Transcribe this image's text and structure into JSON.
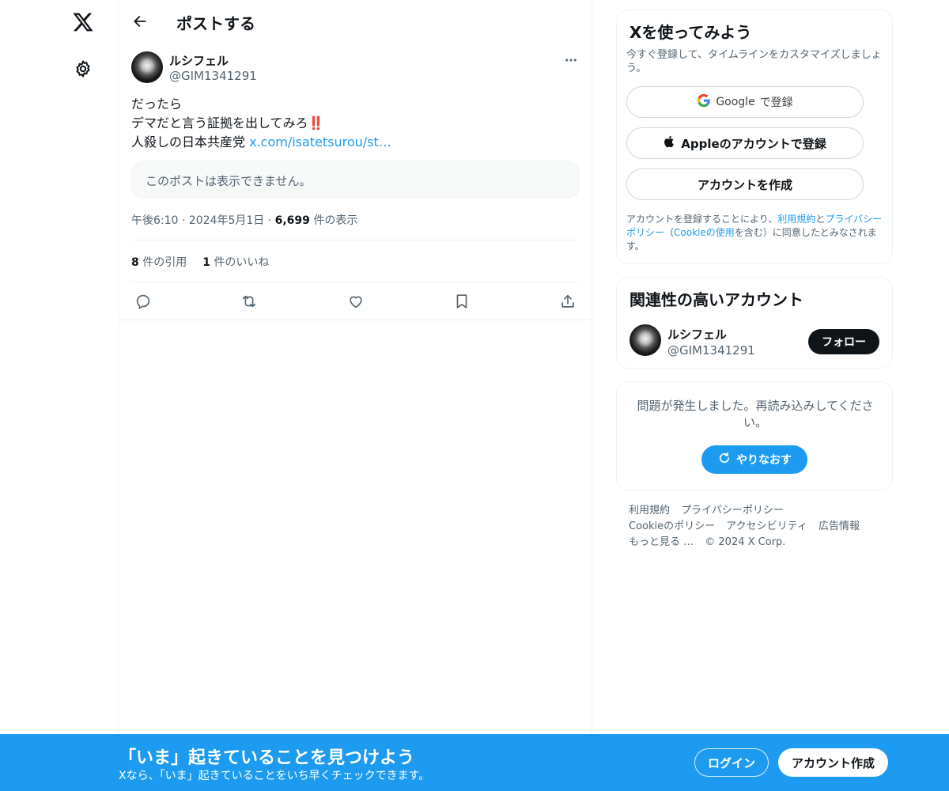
{
  "nav": {
    "logo_icon": "x-logo-icon",
    "settings_icon": "gear-icon"
  },
  "header": {
    "title": "ポストする",
    "back_icon": "arrow-left-icon"
  },
  "post": {
    "author_name": "ルシフェル",
    "author_handle": "@GIM1341291",
    "line1": "だったら",
    "line2": "デマだと言う証拠を出してみろ",
    "line2_emoji": "‼️",
    "line3_text": "人殺しの日本共産党 ",
    "line3_link": "x.com/isatetsurou/st…",
    "quoted_unavailable": "このポストは表示できません。",
    "time": "午後6:10",
    "date": "2024年5月1日",
    "sep": "·",
    "views_count": "6,699",
    "views_label": " 件の表示",
    "quotes_count": "8",
    "quotes_label": " 件の引用",
    "likes_count": "1",
    "likes_label": " 件のいいね"
  },
  "signup_card": {
    "title": "Xを使ってみよう",
    "subtitle": "今すぐ登録して、タイムラインをカスタマイズしましょう。",
    "google_brand": "Google",
    "google_suffix": " で登録",
    "apple_label": "Appleのアカウントで登録",
    "create_label": "アカウントを作成",
    "terms_1": "アカウントを登録することにより、",
    "terms_link1": "利用規約",
    "terms_2": "と",
    "terms_link2": "プライバシーポリシー",
    "terms_3": "（",
    "terms_link3": "Cookieの使用",
    "terms_4": "を含む）に同意したとみなされます。"
  },
  "related": {
    "title": "関連性の高いアカウント",
    "name": "ルシフェル",
    "handle": "@GIM1341291",
    "follow_label": "フォロー"
  },
  "error_card": {
    "message": "問題が発生しました。再読み込みしてください。",
    "retry_label": "やりなおす"
  },
  "footer": {
    "terms": "利用規約",
    "privacy": "プライバシーポリシー",
    "cookie": "Cookieのポリシー",
    "accessibility": "アクセシビリティ",
    "ads": "広告情報",
    "more": "もっと見る …",
    "copyright": "© 2024 X Corp."
  },
  "bottom_bar": {
    "title": "「いま」起きていることを見つけよう",
    "subtitle": "Xなら、「いま」起きていることをいち早くチェックできます。",
    "login_label": "ログイン",
    "signup_label": "アカウント作成"
  },
  "colors": {
    "accent": "#1d9bf0",
    "text": "#0f1419",
    "muted": "#536471",
    "border": "#eff3f4"
  }
}
